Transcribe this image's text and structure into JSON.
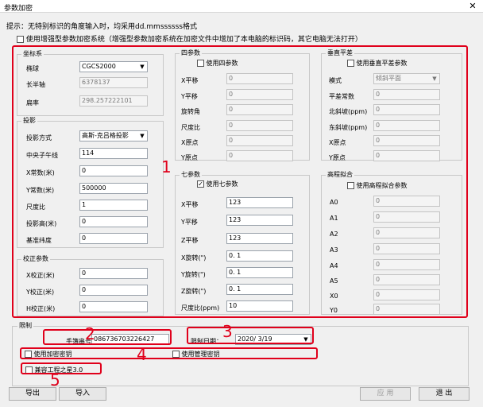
{
  "window": {
    "title": "参数加密",
    "close_glyph": "✕"
  },
  "hint": "提示：无特别标识的角度输入时，均采用dd.mmssssss格式",
  "enhanced": {
    "checked": false,
    "label": "使用增强型参数加密系统（增强型参数加密系统在加密文件中增加了本电脑的标识码，其它电脑无法打开）"
  },
  "coord": {
    "title": "坐标系",
    "ellipsoid_label": "椭球",
    "ellipsoid_value": "CGCS2000",
    "major_label": "长半轴",
    "major_value": "6378137",
    "flat_label": "扁率",
    "flat_value": "298.257222101"
  },
  "proj": {
    "title": "投影",
    "method_label": "投影方式",
    "method_value": "高斯-克吕格投影",
    "cm_label": "中央子午线",
    "cm_value": "114",
    "x_label": "X常数(米)",
    "x_value": "0",
    "y_label": "Y常数(米)",
    "y_value": "500000",
    "scale_label": "尺度比",
    "scale_value": "1",
    "height_label": "投影高(米)",
    "height_value": "0",
    "lat_label": "基准纬度",
    "lat_value": "0"
  },
  "corr": {
    "title": "校正参数",
    "x_label": "X校正(米)",
    "x_value": "0",
    "y_label": "Y校正(米)",
    "y_value": "0",
    "h_label": "H校正(米)",
    "h_value": "0"
  },
  "four": {
    "title": "四参数",
    "checked": false,
    "use_label": "使用四参数",
    "rows": [
      {
        "label": "X平移",
        "value": "0"
      },
      {
        "label": "Y平移",
        "value": "0"
      },
      {
        "label": "旋转角",
        "value": "0"
      },
      {
        "label": "尺度比",
        "value": "0"
      },
      {
        "label": "X原点",
        "value": "0"
      },
      {
        "label": "Y原点",
        "value": "0"
      }
    ]
  },
  "seven": {
    "title": "七参数",
    "checked": true,
    "use_label": "使用七参数",
    "rows": [
      {
        "label": "X平移",
        "value": "123"
      },
      {
        "label": "Y平移",
        "value": "123"
      },
      {
        "label": "Z平移",
        "value": "123"
      },
      {
        "label": "X旋转(\")",
        "value": "0. 1"
      },
      {
        "label": "Y旋转(\")",
        "value": "0. 1"
      },
      {
        "label": "Z旋转(\")",
        "value": "0. 1"
      },
      {
        "label": "尺度比(ppm)",
        "value": "10"
      }
    ]
  },
  "vert": {
    "title": "垂直平差",
    "checked": false,
    "use_label": "使用垂直平差参数",
    "mode_label": "模式",
    "mode_value": "倾斜平面",
    "rows": [
      {
        "label": "平差常数",
        "value": "0"
      },
      {
        "label": "北斜坡(ppm)",
        "value": "0"
      },
      {
        "label": "东斜坡(ppm)",
        "value": "0"
      },
      {
        "label": "X原点",
        "value": "0"
      },
      {
        "label": "Y原点",
        "value": "0"
      }
    ]
  },
  "elev": {
    "title": "高程拟合",
    "checked": false,
    "use_label": "使用高程拟合参数",
    "rows": [
      {
        "label": "A0",
        "value": "0"
      },
      {
        "label": "A1",
        "value": "0"
      },
      {
        "label": "A2",
        "value": "0"
      },
      {
        "label": "A3",
        "value": "0"
      },
      {
        "label": "A4",
        "value": "0"
      },
      {
        "label": "A5",
        "value": "0"
      },
      {
        "label": "X0",
        "value": "0"
      },
      {
        "label": "Y0",
        "value": "0"
      }
    ]
  },
  "limit": {
    "title": "限制",
    "phone_label": "手簿串号：",
    "phone_value": "086736703226427",
    "date_label": "限制日期：",
    "date_value": "2020/ 3/19",
    "enc_key_label": "使用加密密钥",
    "enc_key_checked": false,
    "mgr_key_label": "使用管理密钥",
    "mgr_key_checked": false,
    "compat_label": "兼容工程之星3.0",
    "compat_checked": false
  },
  "annotations": [
    "1",
    "2",
    "3",
    "4",
    "5"
  ],
  "buttons": {
    "export": "导出",
    "import": "导入",
    "apply": "应 用",
    "exit": "退 出"
  },
  "colors": {
    "annotation": "#e0001b"
  }
}
